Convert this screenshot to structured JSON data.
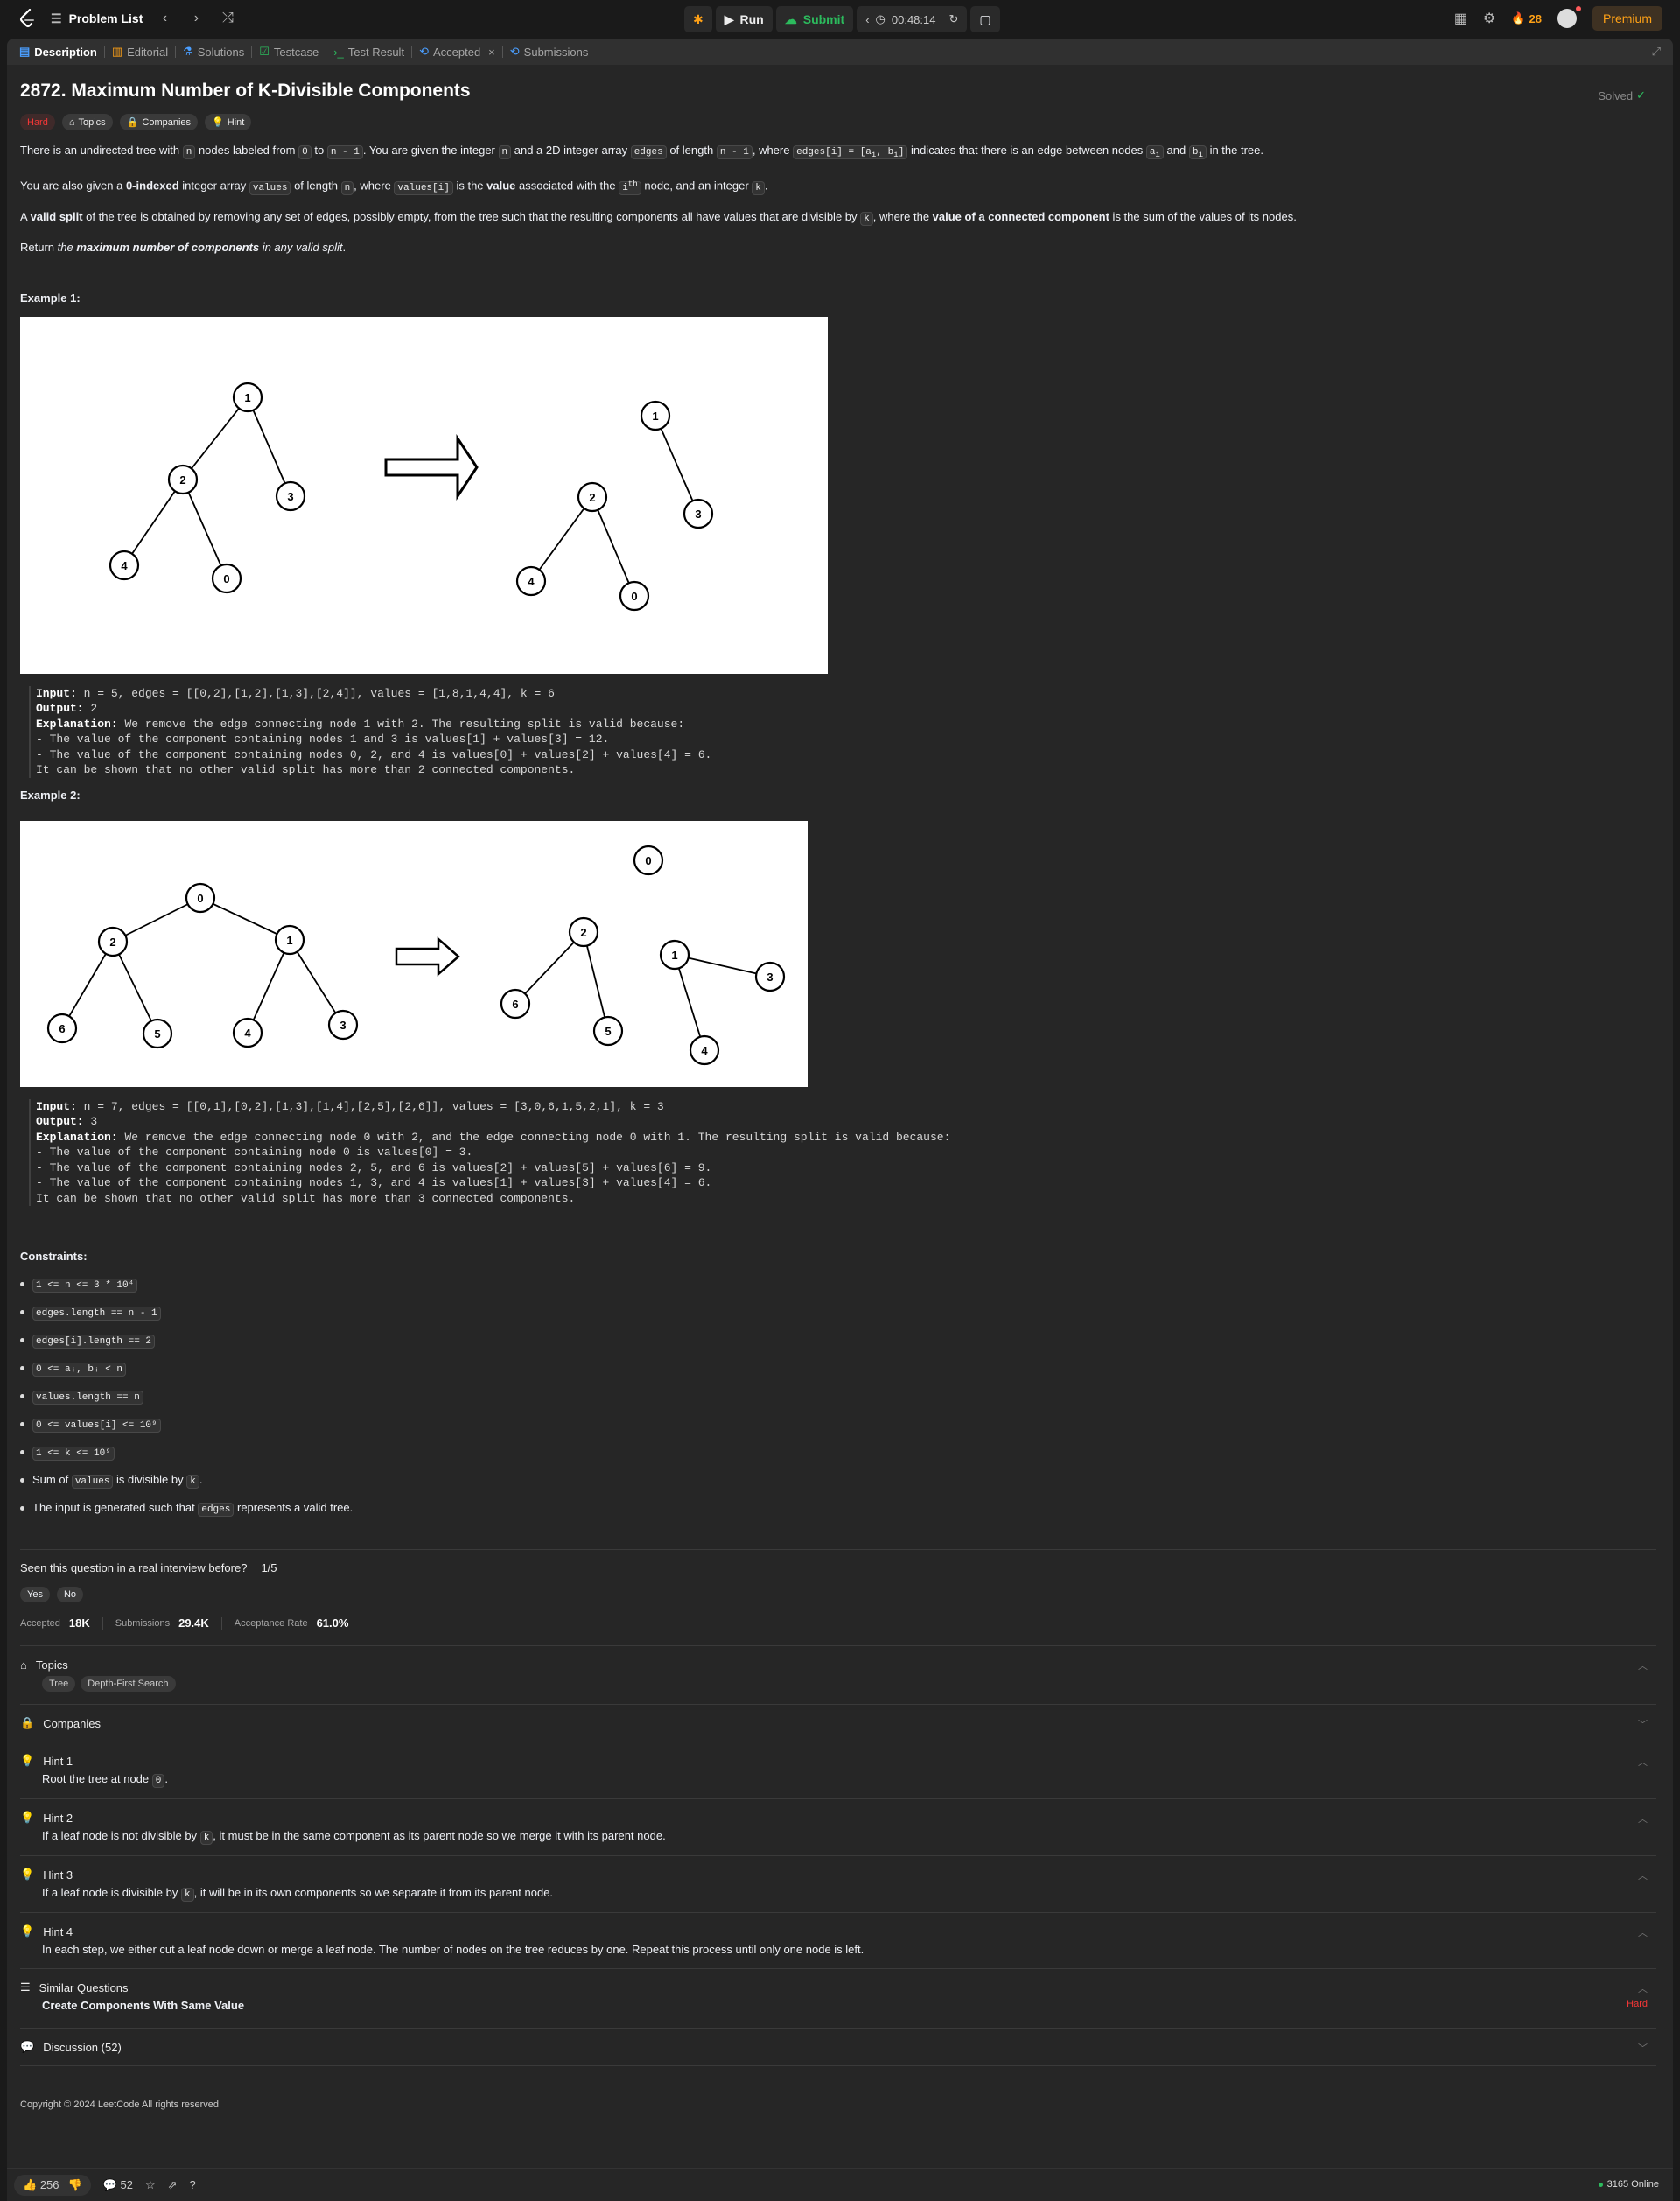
{
  "topbar": {
    "problem_list": "Problem List",
    "run": "Run",
    "submit": "Submit",
    "timer": "00:48:14",
    "streak": "28",
    "premium": "Premium"
  },
  "tabs": [
    {
      "label": "Description"
    },
    {
      "label": "Editorial"
    },
    {
      "label": "Solutions"
    },
    {
      "label": "Testcase"
    },
    {
      "label": "Test Result"
    },
    {
      "label": "Accepted"
    },
    {
      "label": "Submissions"
    }
  ],
  "problem": {
    "title": "2872. Maximum Number of K-Divisible Components",
    "status": "Solved",
    "difficulty": "Hard",
    "chip_topics": "Topics",
    "chip_companies": "Companies",
    "chip_hint": "Hint",
    "example1_heading": "Example 1:",
    "example2_heading": "Example 2:",
    "constraints_heading": "Constraints:"
  },
  "examples": [
    {
      "input": "n = 5, edges = [[0,2],[1,2],[1,3],[2,4]], values = [1,8,1,4,4], k = 6",
      "output": "2",
      "explanation": "We remove the edge connecting node 1 with 2. The resulting split is valid because:",
      "lines": [
        "- The value of the component containing nodes 1 and 3 is values[1] + values[3] = 12.",
        "- The value of the component containing nodes 0, 2, and 4 is values[0] + values[2] + values[4] = 6.",
        "It can be shown that no other valid split has more than 2 connected components."
      ]
    },
    {
      "input": "n = 7, edges = [[0,1],[0,2],[1,3],[1,4],[2,5],[2,6]], values = [3,0,6,1,5,2,1], k = 3",
      "output": "3",
      "explanation": "We remove the edge connecting node 0 with 2, and the edge connecting node 0 with 1. The resulting split is valid because:",
      "lines": [
        "- The value of the component containing node 0 is values[0] = 3.",
        "- The value of the component containing nodes 2, 5, and 6 is values[2] + values[5] + values[6] = 9.",
        "- The value of the component containing nodes 1, 3, and 4 is values[1] + values[3] + values[4] = 6.",
        "It can be shown that no other valid split has more than 3 connected components."
      ]
    }
  ],
  "constraints": [
    "1 <= n <= 3 * 10⁴",
    "edges.length == n - 1",
    "edges[i].length == 2",
    "0 <= aᵢ, bᵢ < n",
    "values.length == n",
    "0 <= values[i] <= 10⁹",
    "1 <= k <= 10⁹"
  ],
  "constraint_sum": {
    "pre": "Sum of",
    "code1": "values",
    "mid": "is divisible by",
    "code2": "k",
    "post": "."
  },
  "constraint_gen": {
    "pre": "The input is generated such that",
    "code": "edges",
    "post": "represents a valid tree."
  },
  "interview": {
    "question": "Seen this question in a real interview before?",
    "count": "1/5",
    "yes": "Yes",
    "no": "No"
  },
  "stats": {
    "accepted_label": "Accepted",
    "accepted": "18K",
    "submissions_label": "Submissions",
    "submissions": "29.4K",
    "rate_label": "Acceptance Rate",
    "rate": "61.0%"
  },
  "sections": {
    "topics": "Topics",
    "topic_tags": [
      "Tree",
      "Depth-First Search"
    ],
    "companies": "Companies",
    "hint1_title": "Hint 1",
    "hint2_title": "Hint 2",
    "hint3_title": "Hint 3",
    "hint4_title": "Hint 4",
    "similar": "Similar Questions",
    "similar_q": "Create Components With Same Value",
    "similar_diff": "Hard",
    "discussion": "Discussion (52)"
  },
  "hints": {
    "h1_pre": "Root the tree at node",
    "h1_code": "0",
    "h1_post": ".",
    "h2_pre": "If a leaf node is not divisible by",
    "h2_code": "k",
    "h2_post": ", it must be in the same component as its parent node so we merge it with its parent node.",
    "h3_pre": "If a leaf node is divisible by",
    "h3_code": "k",
    "h3_post": ", it will be in its own components so we separate it from its parent node.",
    "h4": "In each step, we either cut a leaf node down or merge a leaf node. The number of nodes on the tree reduces by one. Repeat this process until only one node is left."
  },
  "copyright": "Copyright © 2024 LeetCode All rights reserved",
  "bottom": {
    "likes": "256",
    "comments": "52",
    "online": "3165 Online"
  },
  "colors": {
    "accent": "#ffa116",
    "green": "#2cbb5d",
    "hard": "#f63737"
  }
}
